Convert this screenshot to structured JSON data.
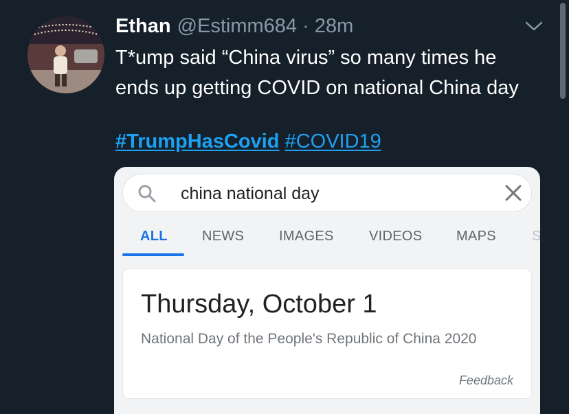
{
  "tweet": {
    "display_name": "Ethan",
    "handle_time": "@Estimm684 · 28m",
    "text": "T*ump said “China virus” so many times he ends up getting COVID on national China day",
    "hashtags": [
      "#TrumpHasCovid",
      "#COVID19"
    ]
  },
  "search": {
    "query": "china national day",
    "tabs": [
      "ALL",
      "NEWS",
      "IMAGES",
      "VIDEOS",
      "MAPS",
      "S"
    ],
    "active_tab": "ALL"
  },
  "result": {
    "date": "Thursday, October 1",
    "description": "National Day of the People's Republic of China 2020",
    "feedback": "Feedback"
  },
  "colors": {
    "background": "#15202b",
    "link": "#1da1f2",
    "google_blue": "#1a73e8",
    "muted": "#8899a6"
  }
}
